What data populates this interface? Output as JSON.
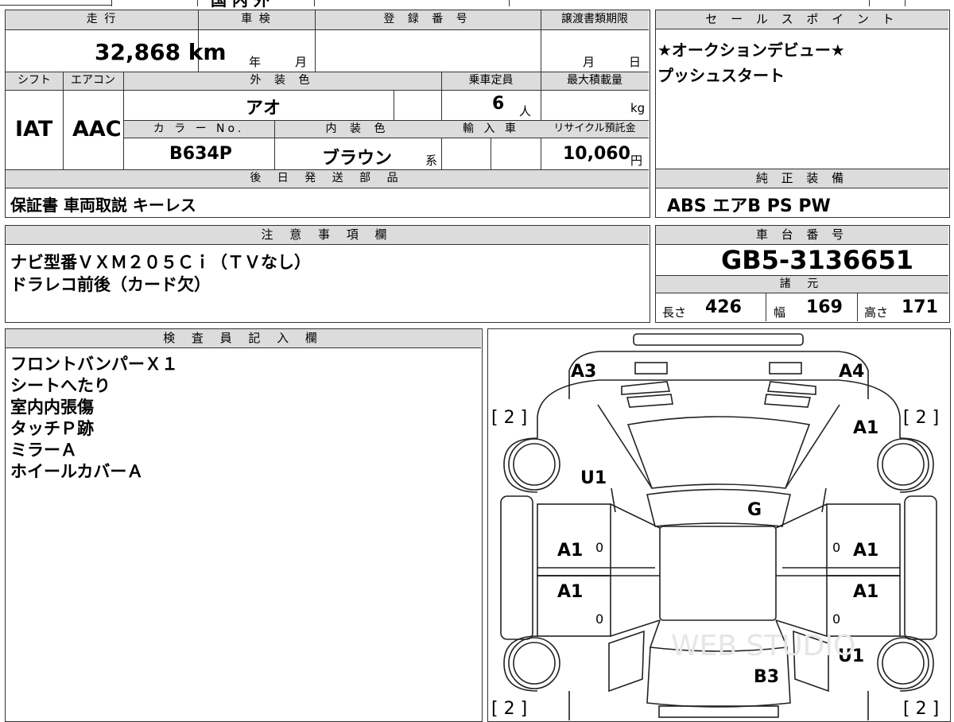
{
  "top_strip": {
    "fragment": "国 内 外"
  },
  "table": {
    "mileage_label": "走 行",
    "mileage_value": "32,868 km",
    "inspection_label": "車 検",
    "year_unit": "年",
    "month_unit": "月",
    "registration_label": "登 録 番 号",
    "transfer_label": "譲渡書類期限",
    "transfer_month": "月",
    "transfer_day": "日",
    "shift_label": "シフト",
    "shift_value": "IAT",
    "ac_label": "エアコン",
    "ac_value": "AAC",
    "exterior_label": "外 装 色",
    "exterior_value": "アオ",
    "capacity_label": "乗車定員",
    "capacity_value": "6",
    "capacity_unit": "人",
    "load_label": "最大積載量",
    "load_unit": "kg",
    "color_no_label": "カ ラ ー No.",
    "color_no_value": "B634P",
    "interior_label": "内 装 色",
    "interior_value": "ブラウン",
    "interior_suffix": "系",
    "import_label": "輸 入 車",
    "recycle_label": "リサイクル預託金",
    "recycle_value": "10,060",
    "recycle_unit": "円",
    "later_parts_label": "後 日 発 送 部 品",
    "later_parts_value": "保証書 車両取説 キーレス"
  },
  "sales_point": {
    "label": "セ ー ル ス ポ イ ン ト",
    "lines": [
      "★オークションデビュー★",
      "プッシュスタート"
    ]
  },
  "standard_equipment": {
    "label": "純 正 装 備",
    "value": "ABS エアB PS PW"
  },
  "notes": {
    "label": "注 意 事 項 欄",
    "lines": [
      "ナビ型番ＶＸＭ２０５Ｃｉ（ＴＶなし）",
      "ドラレコ前後（カード欠）"
    ]
  },
  "chassis": {
    "label": "車 台 番 号",
    "value": "GB5-3136651",
    "spec_label": "諸 元",
    "length_label": "長さ",
    "length_value": "426",
    "width_label": "幅",
    "width_value": "169",
    "height_label": "高さ",
    "height_value": "171"
  },
  "inspector": {
    "label": "検 査 員 記 入 欄",
    "lines": [
      "フロントバンパーＸ１",
      "シートへたり",
      "室内内張傷",
      "タッチＰ跡",
      "ミラーＡ",
      "ホイールカバーＡ"
    ]
  },
  "diagram": {
    "marks": {
      "a3": "A3",
      "a4": "A4",
      "a1_right_top": "A1",
      "u1_left": "U1",
      "g": "G",
      "a1_left_front": "A1",
      "a1_right_front": "A1",
      "a1_left_rear": "A1",
      "a1_right_rear": "A1",
      "u1_right": "U1",
      "b3": "B3"
    },
    "tire_tl": "[ 2 ]",
    "tire_tr": "[ 2 ]",
    "tire_bl": "[ 2 ]",
    "tire_br": "[ 2 ]",
    "zero_1": "0",
    "zero_2": "0",
    "zero_3": "0",
    "zero_4": "0",
    "watermark": "WEB STUDIO"
  }
}
